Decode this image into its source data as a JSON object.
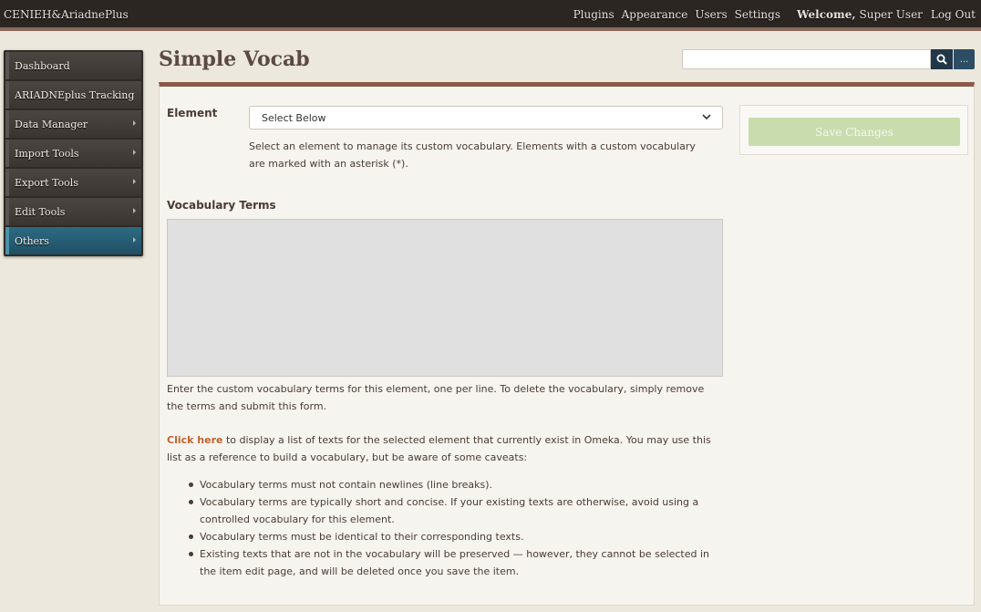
{
  "header": {
    "site_title": "CENIEH&AriadnePlus",
    "nav": [
      "Plugins",
      "Appearance",
      "Users",
      "Settings"
    ],
    "welcome_label": "Welcome,",
    "user_name": "Super User",
    "logout_label": "Log Out"
  },
  "sidebar": {
    "items": [
      {
        "label": "Dashboard",
        "has_submenu": false
      },
      {
        "label": "ARIADNEplus Tracking",
        "has_submenu": false
      },
      {
        "label": "Data Manager",
        "has_submenu": true
      },
      {
        "label": "Import Tools",
        "has_submenu": true
      },
      {
        "label": "Export Tools",
        "has_submenu": true
      },
      {
        "label": "Edit Tools",
        "has_submenu": true
      },
      {
        "label": "Others",
        "has_submenu": true,
        "active": true
      }
    ]
  },
  "page": {
    "title": "Simple Vocab"
  },
  "search": {
    "value": "",
    "placeholder": "",
    "advanced_label": "..."
  },
  "form": {
    "element_label": "Element",
    "element_select_value": "Select Below",
    "element_help": "Select an element to manage its custom vocabulary. Elements with a custom vocabulary are marked with an asterisk (*).",
    "terms_label": "Vocabulary Terms",
    "terms_value": "",
    "terms_help": "Enter the custom vocabulary terms for this element, one per line. To delete the vocabulary, simply remove the terms and submit this form.",
    "click_here_label": "Click here",
    "texts_intro": " to display a list of texts for the selected element that currently exist in Omeka. You may use this list as a reference to build a vocabulary, but be aware of some caveats:",
    "caveats": [
      "Vocabulary terms must not contain newlines (line breaks).",
      "Vocabulary terms are typically short and concise. If your existing texts are otherwise, avoid using a controlled vocabulary for this element.",
      "Vocabulary terms must be identical to their corresponding texts.",
      "Existing texts that are not in the vocabulary will be preserved — however, they cannot be selected in the item edit page, and will be deleted once you save the item."
    ]
  },
  "actions": {
    "save_label": "Save Changes"
  },
  "colors": {
    "topbar": "#2b2622",
    "sidebar_active": "#2d6a82",
    "panel_accent": "#8a5a48",
    "link": "#c0622e",
    "save_button": "#c9dcae"
  }
}
